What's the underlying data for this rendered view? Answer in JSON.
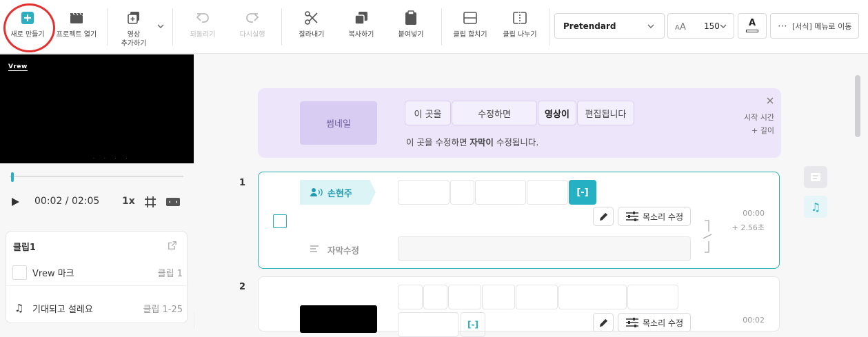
{
  "toolbar": {
    "new_project": "새로 만들기",
    "open_project": "프로젝트 열기",
    "add_video_line1": "영상",
    "add_video_line2": "추가하기",
    "undo": "되돌리기",
    "redo": "다시실행",
    "cut": "잘라내기",
    "copy": "복사하기",
    "paste": "붙여넣기",
    "merge_clip": "클립 합치기",
    "split_clip": "클립 나누기",
    "font_value": "Pretendard",
    "font_size_value": "150",
    "text_color_letter": "A",
    "more_menu": "[서식] 메뉴로 이동",
    "accent_color": "#2ab0c2",
    "annotation_color": "#e53030"
  },
  "player": {
    "watermark": "Vrew",
    "time_display": "00:02 / 02:05",
    "speed": "1x"
  },
  "clip_panel": {
    "title": "클립1",
    "rows": [
      {
        "label": "Vrew 마크",
        "range": "클립 1"
      },
      {
        "label": "기대되고 설레요",
        "range": "클립 1-25"
      }
    ]
  },
  "guide": {
    "thumbnail_label": "썸네일",
    "words": [
      "이  곳을",
      "수정하면",
      "영상이",
      "편집됩니다"
    ],
    "subtitle_prefix": "이  곳을  수정하면 ",
    "subtitle_bold": "자막이",
    "subtitle_suffix": " 수정됩니다.",
    "start_time_label": "시작 시간",
    "length_label": "+ 길이"
  },
  "clips": [
    {
      "number": "1",
      "speaker": "손현주",
      "silence_token": "[-]",
      "voice_edit": "목소리 수정",
      "subtitle_label": "자막수정",
      "start": "00:00",
      "duration": "+  2.56초"
    },
    {
      "number": "2",
      "silence_token": "[-]",
      "voice_edit": "목소리 수정",
      "start": "00:02"
    }
  ]
}
